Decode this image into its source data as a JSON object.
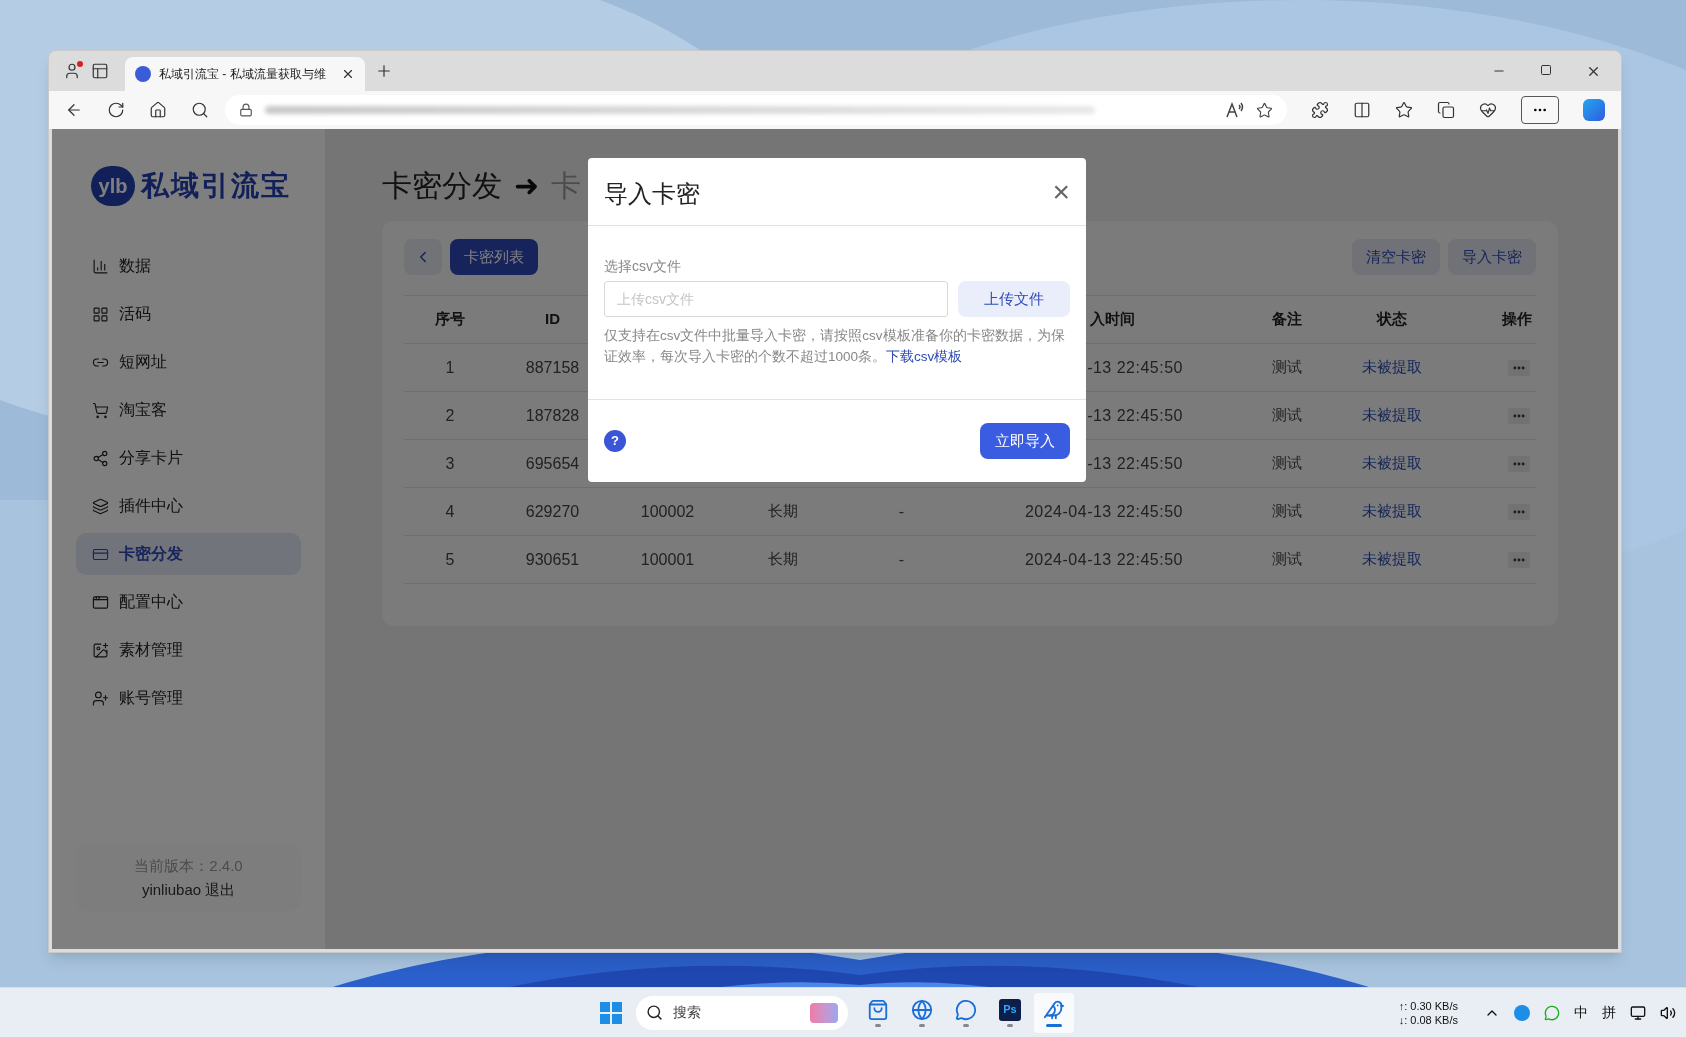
{
  "browser": {
    "tab_title": "私域引流宝 - 私域流量获取与维"
  },
  "sidebar": {
    "logo_badge": "ylb",
    "logo_text": "私域引流宝",
    "items": [
      {
        "label": "数据",
        "selected": false
      },
      {
        "label": "活码",
        "selected": false
      },
      {
        "label": "短网址",
        "selected": false
      },
      {
        "label": "淘宝客",
        "selected": false
      },
      {
        "label": "分享卡片",
        "selected": false
      },
      {
        "label": "插件中心",
        "selected": false
      },
      {
        "label": "卡密分发",
        "selected": true
      },
      {
        "label": "配置中心",
        "selected": false
      },
      {
        "label": "素材管理",
        "selected": false
      },
      {
        "label": "账号管理",
        "selected": false
      }
    ],
    "version": "当前版本：2.4.0",
    "user": "yinliubao",
    "logout": "退出"
  },
  "page": {
    "breadcrumb": [
      "卡密分发",
      "卡"
    ],
    "arrow": "➜",
    "list_button": "卡密列表",
    "clear_button": "清空卡密",
    "import_button": "导入卡密"
  },
  "table": {
    "columns_left": [
      "序号",
      "ID"
    ],
    "columns_right": [
      "入时间",
      "备注",
      "状态",
      "操作"
    ],
    "rows": [
      {
        "index": "1",
        "id": "887158",
        "time": "-13 22:45:50",
        "note": "测试",
        "status": "未被提取"
      },
      {
        "index": "2",
        "id": "187828",
        "time": "-13 22:45:50",
        "note": "测试",
        "status": "未被提取"
      },
      {
        "index": "3",
        "id": "695654",
        "time": "-13 22:45:50",
        "note": "测试",
        "status": "未被提取"
      },
      {
        "index": "4",
        "id": "629270",
        "column_3": "100002",
        "column_4": "长期",
        "column_5": "-",
        "time": "2024-04-13 22:45:50",
        "note": "测试",
        "status": "未被提取"
      },
      {
        "index": "5",
        "id": "930651",
        "column_3": "100001",
        "column_4": "长期",
        "column_5": "-",
        "time": "2024-04-13 22:45:50",
        "note": "测试",
        "status": "未被提取"
      }
    ]
  },
  "dialog": {
    "title": "导入卡密",
    "close": "×",
    "field_label": "选择csv文件",
    "placeholder": "上传csv文件",
    "upload_button": "上传文件",
    "help": "仅支持在csv文件中批量导入卡密，请按照csv模板准备你的卡密数据，为保证效率，每次导入卡密的个数不超过1000条。",
    "help_link": "下载csv模板",
    "help_icon": "?",
    "submit": "立即导入"
  },
  "taskbar": {
    "search_placeholder": "搜索",
    "apps": [
      {
        "selected": false
      },
      {
        "selected": false
      },
      {
        "selected": false
      },
      {
        "label": "Ps",
        "selected": false
      },
      {
        "selected": true
      }
    ],
    "upload_speed": "↑: 0.30 KB/s",
    "download_speed": "↓: 0.08 KB/s",
    "ime_mode": "中",
    "ime": "拼"
  }
}
